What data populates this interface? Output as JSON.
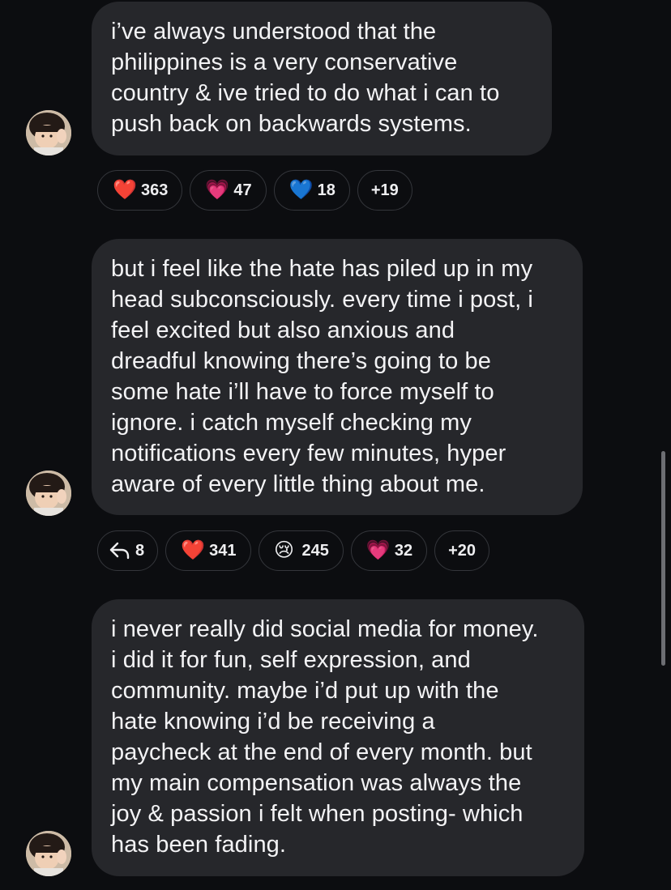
{
  "messages": [
    {
      "text": "i’ve always understood that the\nphilippines is a very conservative\ncountry & ive tried to do what i can to\npush back on backwards systems.",
      "reactions": [
        {
          "emoji": "❤️",
          "icon": "red-heart-icon",
          "count": "363"
        },
        {
          "emoji": "💗",
          "icon": "pink-heart-icon",
          "count": "47"
        },
        {
          "emoji": "💙",
          "icon": "blue-heart-icon",
          "count": "18"
        }
      ],
      "more": "+19"
    },
    {
      "text": "but i feel like the hate has piled up in my\nhead subconsciously. every time i post, i\nfeel excited but also anxious and\ndreadful knowing there’s going to be\nsome hate i’ll have to force myself to\nignore. i catch myself checking my\nnotifications every few minutes, hyper\naware of every little thing about me.",
      "reply_count": "8",
      "reactions": [
        {
          "emoji": "❤️",
          "icon": "red-heart-icon",
          "count": "341"
        },
        {
          "emoji": "😢",
          "icon": "crying-face-icon",
          "count": "245"
        },
        {
          "emoji": "💗",
          "icon": "pink-heart-icon",
          "count": "32"
        }
      ],
      "more": "+20"
    },
    {
      "text": "i never really did social media for money.\ni did it for fun, self expression, and\ncommunity. maybe i’d put up with the\nhate knowing i’d be receiving a\npaycheck at the end of every month. but\nmy main compensation was always the\njoy & passion i felt when posting- which\nhas been fading."
    }
  ],
  "colors": {
    "background": "#0c0d10",
    "bubble": "#26272b",
    "chip_border": "#34363b",
    "text": "#f3f3f5"
  }
}
